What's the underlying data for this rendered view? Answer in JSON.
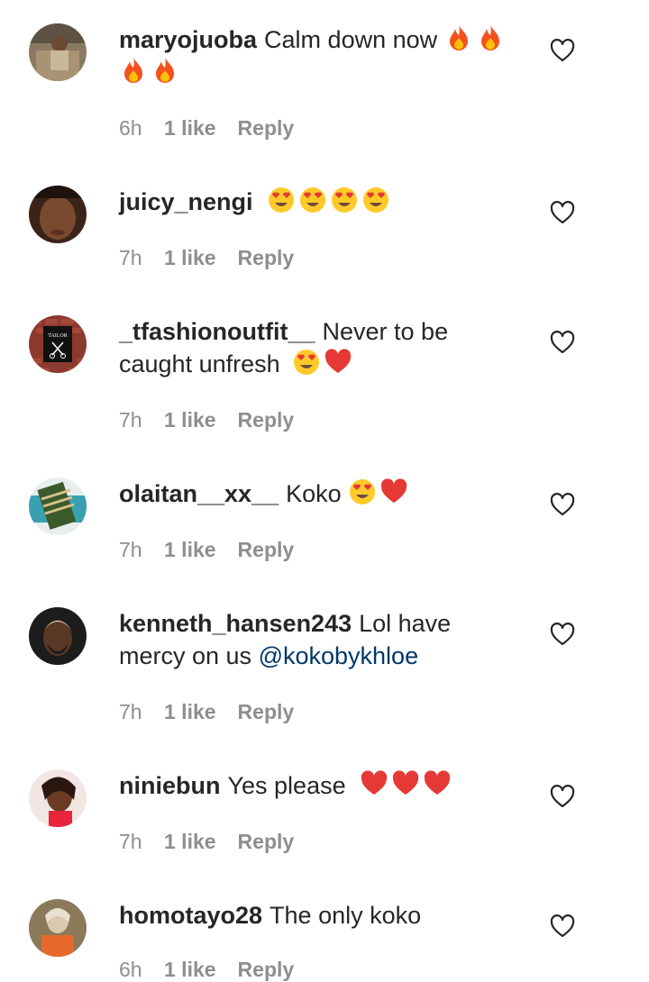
{
  "comments": [
    {
      "username": "maryojuoba",
      "text": "Calm down now",
      "emojis": [
        "fire",
        "fire",
        "fire",
        "fire"
      ],
      "time": "6h",
      "likes": "1 like",
      "reply": "Reply"
    },
    {
      "username": "juicy_nengi",
      "text": "",
      "emojis": [
        "heart-eyes",
        "heart-eyes",
        "heart-eyes",
        "heart-eyes"
      ],
      "time": "7h",
      "likes": "1 like",
      "reply": "Reply"
    },
    {
      "username": "_tfashionoutfit__",
      "text": "Never to be caught unfresh",
      "emojis": [
        "heart-eyes",
        "red-heart"
      ],
      "time": "7h",
      "likes": "1 like",
      "reply": "Reply",
      "avatar_text": "TAILOR"
    },
    {
      "username": "olaitan__xx__",
      "text": "Koko",
      "emojis": [
        "heart-eyes",
        "red-heart"
      ],
      "time": "7h",
      "likes": "1 like",
      "reply": "Reply"
    },
    {
      "username": "kenneth_hansen243",
      "text": "Lol have mercy on us",
      "mention": "@kokobykhloe",
      "emojis": [],
      "time": "7h",
      "likes": "1 like",
      "reply": "Reply"
    },
    {
      "username": "niniebun",
      "text": "Yes please",
      "emojis": [
        "red-heart",
        "red-heart",
        "red-heart"
      ],
      "time": "7h",
      "likes": "1 like",
      "reply": "Reply"
    },
    {
      "username": "homotayo28",
      "text": "The only koko",
      "emojis": [],
      "time": "6h",
      "likes": "1 like",
      "reply": "Reply"
    }
  ],
  "colors": {
    "text": "#262626",
    "meta": "#8e8e8e",
    "mention": "#00376b"
  }
}
